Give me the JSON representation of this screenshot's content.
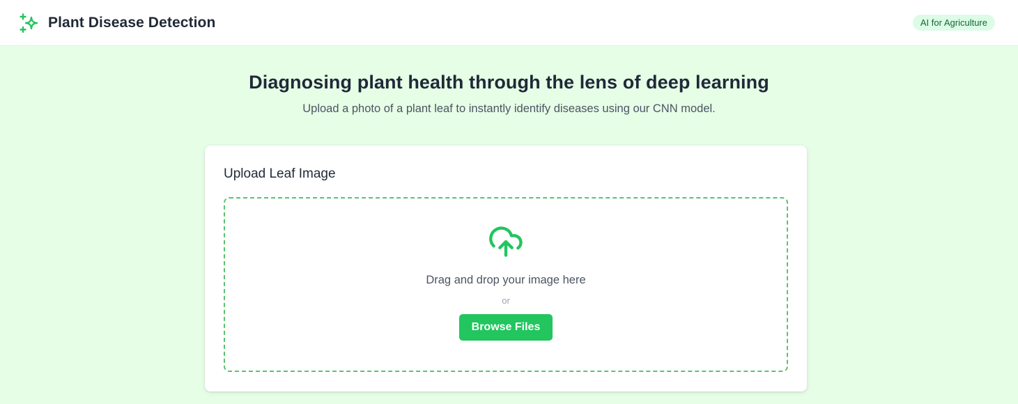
{
  "header": {
    "logo_icon": "sparkles-icon",
    "title": "Plant Disease Detection",
    "badge": "AI for Agriculture"
  },
  "hero": {
    "title": "Diagnosing plant health through the lens of deep learning",
    "subtitle": "Upload a photo of a plant leaf to instantly identify diseases using our CNN model."
  },
  "upload_card": {
    "title": "Upload Leaf Image",
    "dropzone": {
      "icon": "cloud-upload-icon",
      "instruction": "Drag and drop your image here",
      "separator": "or",
      "browse_label": "Browse Files"
    }
  },
  "colors": {
    "page_background": "#e6fde6",
    "accent": "#22c55e",
    "badge_background": "#dcfce7",
    "badge_text": "#166534",
    "dropzone_border": "#5cc26e"
  }
}
